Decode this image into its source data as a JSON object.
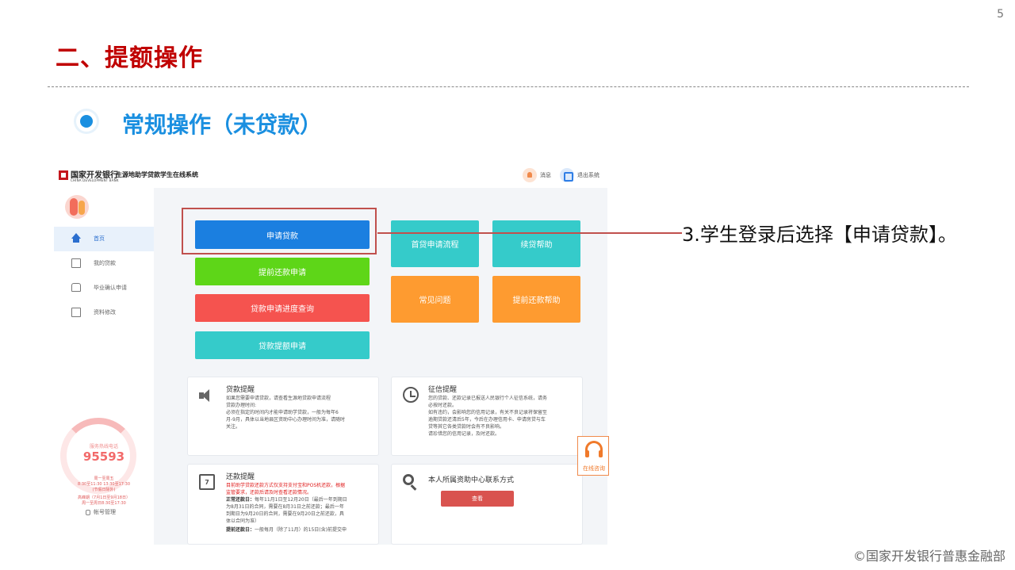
{
  "slide": {
    "page_number": "5",
    "title": "二、提额操作",
    "section_title": "常规操作（未贷款）",
    "callout": "3.学生登录后选择【申请贷款】。",
    "copyright": "©国家开发银行普惠金融部"
  },
  "app": {
    "bank_name": "国家开发银行",
    "bank_name_en": "CHINA DEVELOPMENT BANK",
    "system_name": "生源地助学贷款学生在线系统",
    "header": {
      "message_label": "消息",
      "logout_label": "退出系统"
    },
    "sidebar": {
      "items": [
        {
          "label": "首页",
          "icon": "home-icon",
          "active": true
        },
        {
          "label": "我的贷款",
          "icon": "document-icon",
          "active": false
        },
        {
          "label": "毕业确认申请",
          "icon": "inbox-icon",
          "active": false
        },
        {
          "label": "资料修改",
          "icon": "edit-icon",
          "active": false
        }
      ],
      "stat_label": "服务热线电话",
      "stat_number": "95593",
      "hours_line1": "周一至周五",
      "hours_line2": "8:30至11:30 13:30至17:30",
      "hours_line3": "(节假日除外)",
      "hours_line4": "高峰期（7月1日至9月18日）",
      "hours_line5": "周一至周日8:30至17:30",
      "account_label": "帐号管理"
    },
    "actions": {
      "apply_loan": "申请贷款",
      "early_repayment_apply": "提前还款申请",
      "progress_query": "贷款申请进度查询",
      "loan_increase_apply": "贷款提额申请",
      "first_loan_process": "首贷申请流程",
      "renewal_help": "续贷帮助",
      "faq": "常见问题",
      "early_repayment_help": "提前还款帮助"
    },
    "cards": {
      "loan_reminder": {
        "title": "贷款提醒",
        "lines": [
          "如果您需要申请贷款，请查看生源地贷款申请流程",
          "贷款办理时间:",
          "必须在指定的时间内才能申请助学贷款，一般为每年6",
          "月-9月，具体以当地县区资助中心办理时间为准，请随时",
          "关注。"
        ]
      },
      "credit_reminder": {
        "title": "征信提醒",
        "lines": [
          "您的贷款、还款记录已报送人民银行个人征信系统，请务",
          "必按时还款。",
          "如有违约，会影响您的信用记录，有关不良记录将保留至",
          "逾期贷款还清后5年，今后在办理信用卡、申请房贷与车",
          "贷等其它各类贷款时会有不良影响。",
          "请珍惜您的信用记录，及时还款。"
        ]
      },
      "repayment_reminder": {
        "title": "还款提醒",
        "icon_text": "7",
        "red_lines": [
          "目前助学贷款还款方式仅支持支付宝和POS机还款，根据",
          "监管要求，还款后请及时查看还款情况。"
        ],
        "normal_label": "正常还款日：",
        "normal_lines": [
          "每年11月1日至12月20日（最后一年到期日",
          "为8月31日的合同，需要在8月31日之前还款；最后一年",
          "到期日为9月20日的合同，需要在9月20日之前还款，具",
          "体以合同为准）"
        ],
        "early_label": "提前还款日：",
        "early_line": "一般每月（除了11月）的15日(含)前提交申"
      },
      "contact": {
        "title": "本人所属资助中心联系方式",
        "view_button": "查看"
      }
    },
    "consult_label": "在线咨询"
  },
  "colors": {
    "title_red": "#c00000",
    "section_blue": "#1a8fe0",
    "apply_blue": "#1b7fe0",
    "green": "#5ed618",
    "red": "#f5534f",
    "teal": "#35cbca",
    "orange": "#fe9b30",
    "highlight_border": "#c0504d"
  }
}
